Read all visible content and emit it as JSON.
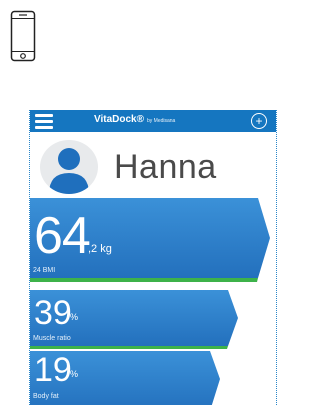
{
  "app": {
    "title": "VitaDock®",
    "title_sub": "by Medisana"
  },
  "icons": {
    "phone": "smartphone-outline-icon",
    "menu": "hamburger-menu-icon",
    "add": "add-circle-icon",
    "avatar": "user-silhouette-icon"
  },
  "user": {
    "name": "Hanna"
  },
  "metrics": [
    {
      "value": "64",
      "unit": ",2 kg",
      "caption": "24 BMI"
    },
    {
      "value": "39",
      "unit": "%",
      "caption": "Muscle ratio"
    },
    {
      "value": "19",
      "unit": "%",
      "caption": "Body fat"
    }
  ],
  "colors": {
    "bar_blue": "#2a7bc6",
    "bar_blue_light": "#3b91d8",
    "accent_green": "#3db24a",
    "appbar": "#1576c0",
    "avatar_blue": "#1f6fbd"
  }
}
